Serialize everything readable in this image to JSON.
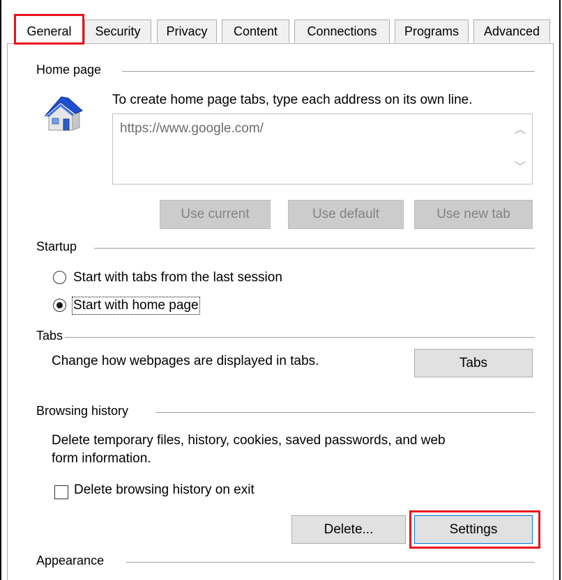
{
  "tabs": [
    {
      "label": "General",
      "active": true
    },
    {
      "label": "Security",
      "active": false
    },
    {
      "label": "Privacy",
      "active": false
    },
    {
      "label": "Content",
      "active": false
    },
    {
      "label": "Connections",
      "active": false
    },
    {
      "label": "Programs",
      "active": false
    },
    {
      "label": "Advanced",
      "active": false
    }
  ],
  "home_page": {
    "title": "Home page",
    "instruction": "To create home page tabs, type each address on its own line.",
    "value": "https://www.google.com/",
    "use_current": "Use current",
    "use_default": "Use default",
    "use_new_tab": "Use new tab"
  },
  "startup": {
    "title": "Startup",
    "option_last_session": "Start with tabs from the last session",
    "option_home_page": "Start with home page",
    "selected": "option_home_page"
  },
  "tabs_group": {
    "title": "Tabs",
    "description": "Change how webpages are displayed in tabs.",
    "button": "Tabs"
  },
  "browsing_history": {
    "title": "Browsing history",
    "description_line1": "Delete temporary files, history, cookies, saved passwords, and web",
    "description_line2": "form information.",
    "delete_on_exit": "Delete browsing history on exit",
    "delete_on_exit_checked": false,
    "delete_button": "Delete...",
    "settings_button": "Settings"
  },
  "appearance": {
    "title": "Appearance"
  },
  "colors": {
    "highlight": "#e8141c",
    "house_roof": "#1f4fd1"
  },
  "icons": {
    "home": "house-icon",
    "scroll_up": "scroll-up-icon",
    "scroll_down": "scroll-down-icon"
  }
}
